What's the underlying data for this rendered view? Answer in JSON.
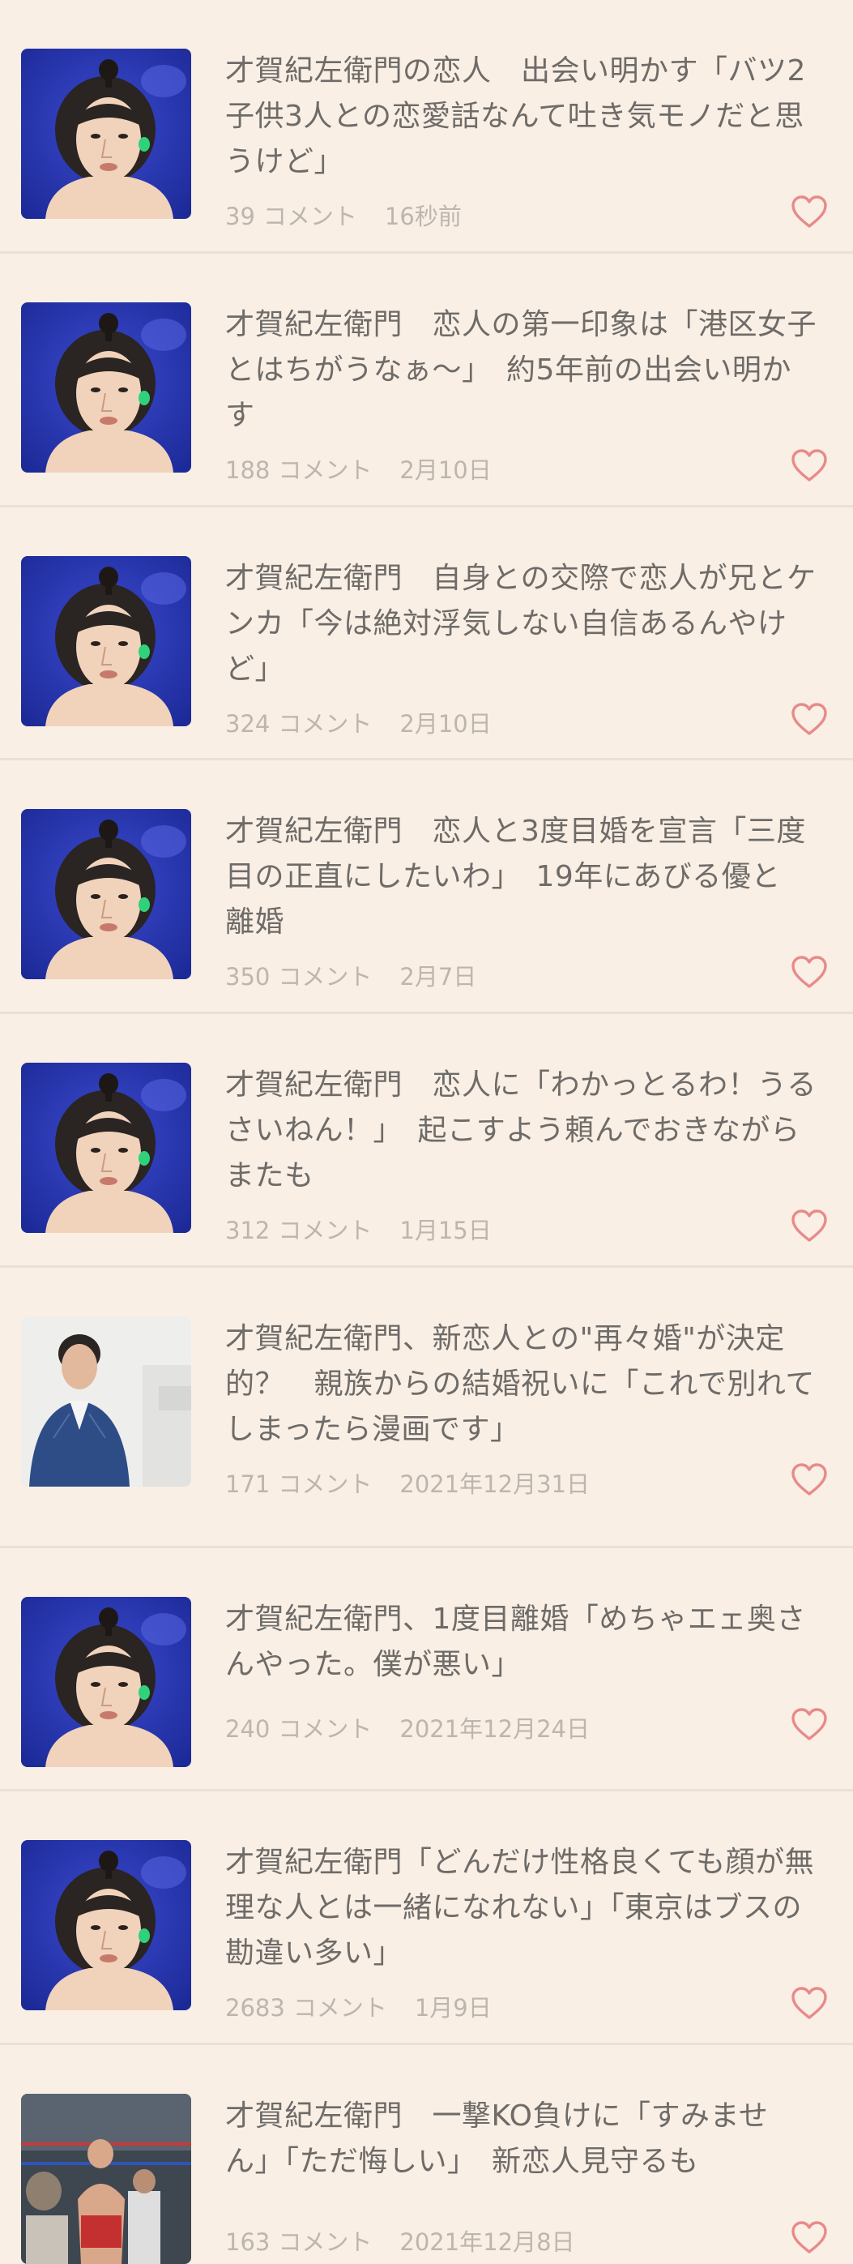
{
  "colors": {
    "background": "#f9efe5",
    "title_text": "#6e6b68",
    "meta_text": "#bdb6ae",
    "heart": "#e88a8a",
    "divider": "#ede0d3"
  },
  "articles": [
    {
      "title": "才賀紀左衛門の恋人　出会い明かす「バツ2\n子供3人との恋愛話なんて吐き気モノだと思\nうけど」",
      "comment_count": "39",
      "comment_suffix": "コメント",
      "time": "16秒前",
      "thumbnail": "man-topknot-portrait",
      "icon": "heart-icon"
    },
    {
      "title": "才賀紀左衛門　恋人の第一印象は「港区女子\nとはちがうなぁ～」　約5年前の出会い明か\nす",
      "comment_count": "188",
      "comment_suffix": "コメント",
      "time": "2月10日",
      "thumbnail": "man-topknot-portrait",
      "icon": "heart-icon"
    },
    {
      "title": "才賀紀左衛門　自身との交際で恋人が兄とケ\nンカ「今は絶対浮気しない自信あるんやけ\nど」",
      "comment_count": "324",
      "comment_suffix": "コメント",
      "time": "2月10日",
      "thumbnail": "man-topknot-portrait",
      "icon": "heart-icon"
    },
    {
      "title": "才賀紀左衛門　恋人と3度目婚を宣言「三度\n目の正直にしたいわ」　19年にあびる優と\n離婚",
      "comment_count": "350",
      "comment_suffix": "コメント",
      "time": "2月7日",
      "thumbnail": "man-topknot-portrait",
      "icon": "heart-icon"
    },
    {
      "title": "才賀紀左衛門　恋人に「わかっとるわ！うる\nさいねん！」　起こすよう頼んでおきながら\nまたも",
      "comment_count": "312",
      "comment_suffix": "コメント",
      "time": "1月15日",
      "thumbnail": "man-topknot-portrait",
      "icon": "heart-icon"
    },
    {
      "title": "才賀紀左衛門、新恋人との\"再々婚\"が決定\n的？　親族からの結婚祝いに「これで別れて\nしまったら漫画です」",
      "comment_count": "171",
      "comment_suffix": "コメント",
      "time": "2021年12月31日",
      "thumbnail": "man-in-suit-portrait",
      "icon": "heart-icon"
    },
    {
      "title": "才賀紀左衛門、1度目離婚「めちゃエェ奥さ\nんやった。僕が悪い」",
      "comment_count": "240",
      "comment_suffix": "コメント",
      "time": "2021年12月24日",
      "thumbnail": "man-topknot-portrait",
      "icon": "heart-icon"
    },
    {
      "title": "才賀紀左衛門「どんだけ性格良くても顔が無\n理な人とは一緒になれない」「東京はブスの\n勘違い多い」",
      "comment_count": "2683",
      "comment_suffix": "コメント",
      "time": "1月9日",
      "thumbnail": "man-topknot-portrait",
      "icon": "heart-icon"
    },
    {
      "title": "才賀紀左衛門　一撃KO負けに「すみませ\nん」「ただ悔しい」　新恋人見守るも",
      "comment_count": "163",
      "comment_suffix": "コメント",
      "time": "2021年12月8日",
      "thumbnail": "fighter-in-ring-photo",
      "icon": "heart-icon"
    }
  ]
}
